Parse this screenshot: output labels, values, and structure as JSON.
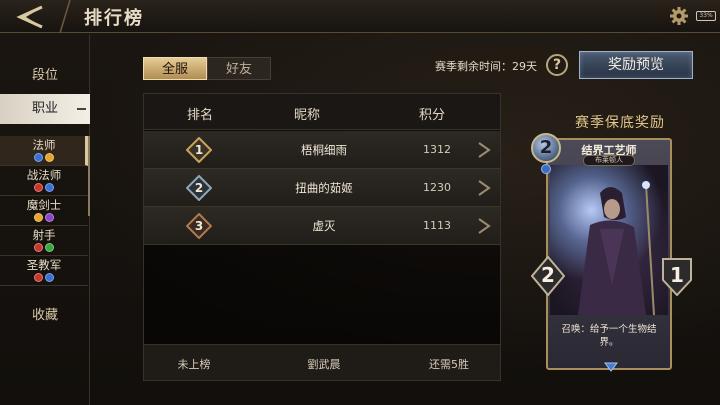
{
  "header": {
    "title": "排行榜",
    "battery": "33%"
  },
  "sidebar": {
    "rank_label": "段位",
    "job_label": "职业",
    "classes": [
      {
        "name": "法师",
        "gems": [
          "#3a6fd8",
          "#e6a52a"
        ]
      },
      {
        "name": "战法师",
        "gems": [
          "#c8362c",
          "#3a6fd8"
        ]
      },
      {
        "name": "魔剑士",
        "gems": [
          "#e6a52a",
          "#8a45c8"
        ]
      },
      {
        "name": "射手",
        "gems": [
          "#c8362c",
          "#3aa83a"
        ]
      },
      {
        "name": "圣教军",
        "gems": [
          "#c8362c",
          "#3a6fd8"
        ]
      }
    ],
    "collect_label": "收藏"
  },
  "tabs": {
    "all": "全服",
    "friends": "好友"
  },
  "season": {
    "remaining_label": "赛季剩余时间：29天",
    "help": "?",
    "preview_button": "奖励预览"
  },
  "table": {
    "headers": {
      "rank": "排名",
      "name": "昵称",
      "score": "积分"
    },
    "rows": [
      {
        "rank": "1",
        "name": "梧桐细雨",
        "score": "1312",
        "badge_color": "#c9a45c"
      },
      {
        "rank": "2",
        "name": "扭曲的茹姬",
        "score": "1230",
        "badge_color": "#8fa8b8"
      },
      {
        "rank": "3",
        "name": "虚灭",
        "score": "1113",
        "badge_color": "#b07a50"
      }
    ],
    "footer": {
      "status": "未上榜",
      "name": "劉武晨",
      "need": "还需5胜"
    }
  },
  "reward": {
    "title": "赛季保底奖励",
    "card": {
      "name": "结界工艺师",
      "type": "布莱顿人",
      "cost": "2",
      "attack": "2",
      "health": "1",
      "description": "召唤：给予一个生物结界。"
    }
  },
  "colors": {
    "accent_gold": "#e0c58c",
    "button_blue": "#4a5a70"
  }
}
